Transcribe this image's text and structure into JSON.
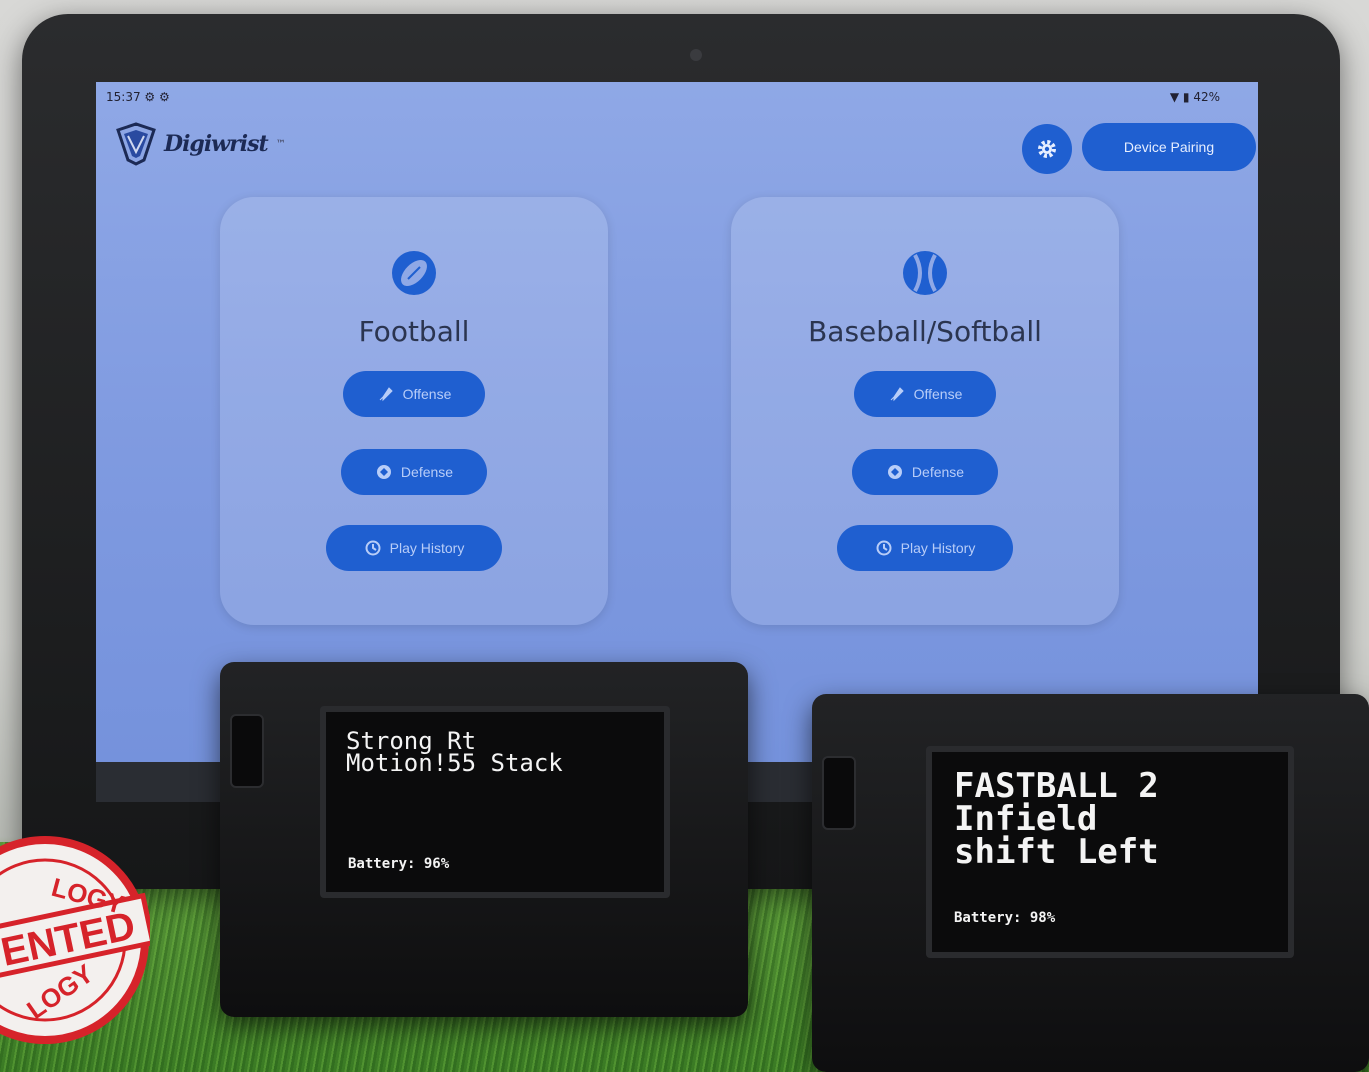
{
  "status": {
    "time": "15:37 ⚙ ⚙",
    "right": "▼ ▮ 42%"
  },
  "app": {
    "logo_text": "Digiwrist",
    "logo_sup": "™"
  },
  "header": {
    "device_pairing_label": "Device Pairing"
  },
  "sports": [
    {
      "title": "Football",
      "offense": "Offense",
      "defense": "Defense",
      "history": "Play History"
    },
    {
      "title": "Baseball/Softball",
      "offense": "Offense",
      "defense": "Defense",
      "history": "Play History"
    }
  ],
  "devices": [
    {
      "line": "Strong Rt\nMotion!55 Stack",
      "battery": "Battery: 96%"
    },
    {
      "line": "FASTBALL 2\nInfield\nshift Left",
      "battery": "Battery: 98%"
    }
  ],
  "stamp": {
    "text": "LOGY ENTED LOGY"
  },
  "colors": {
    "accent": "#1f5fd0",
    "screen": "#8fa8e6",
    "stamp": "#d6232a"
  }
}
